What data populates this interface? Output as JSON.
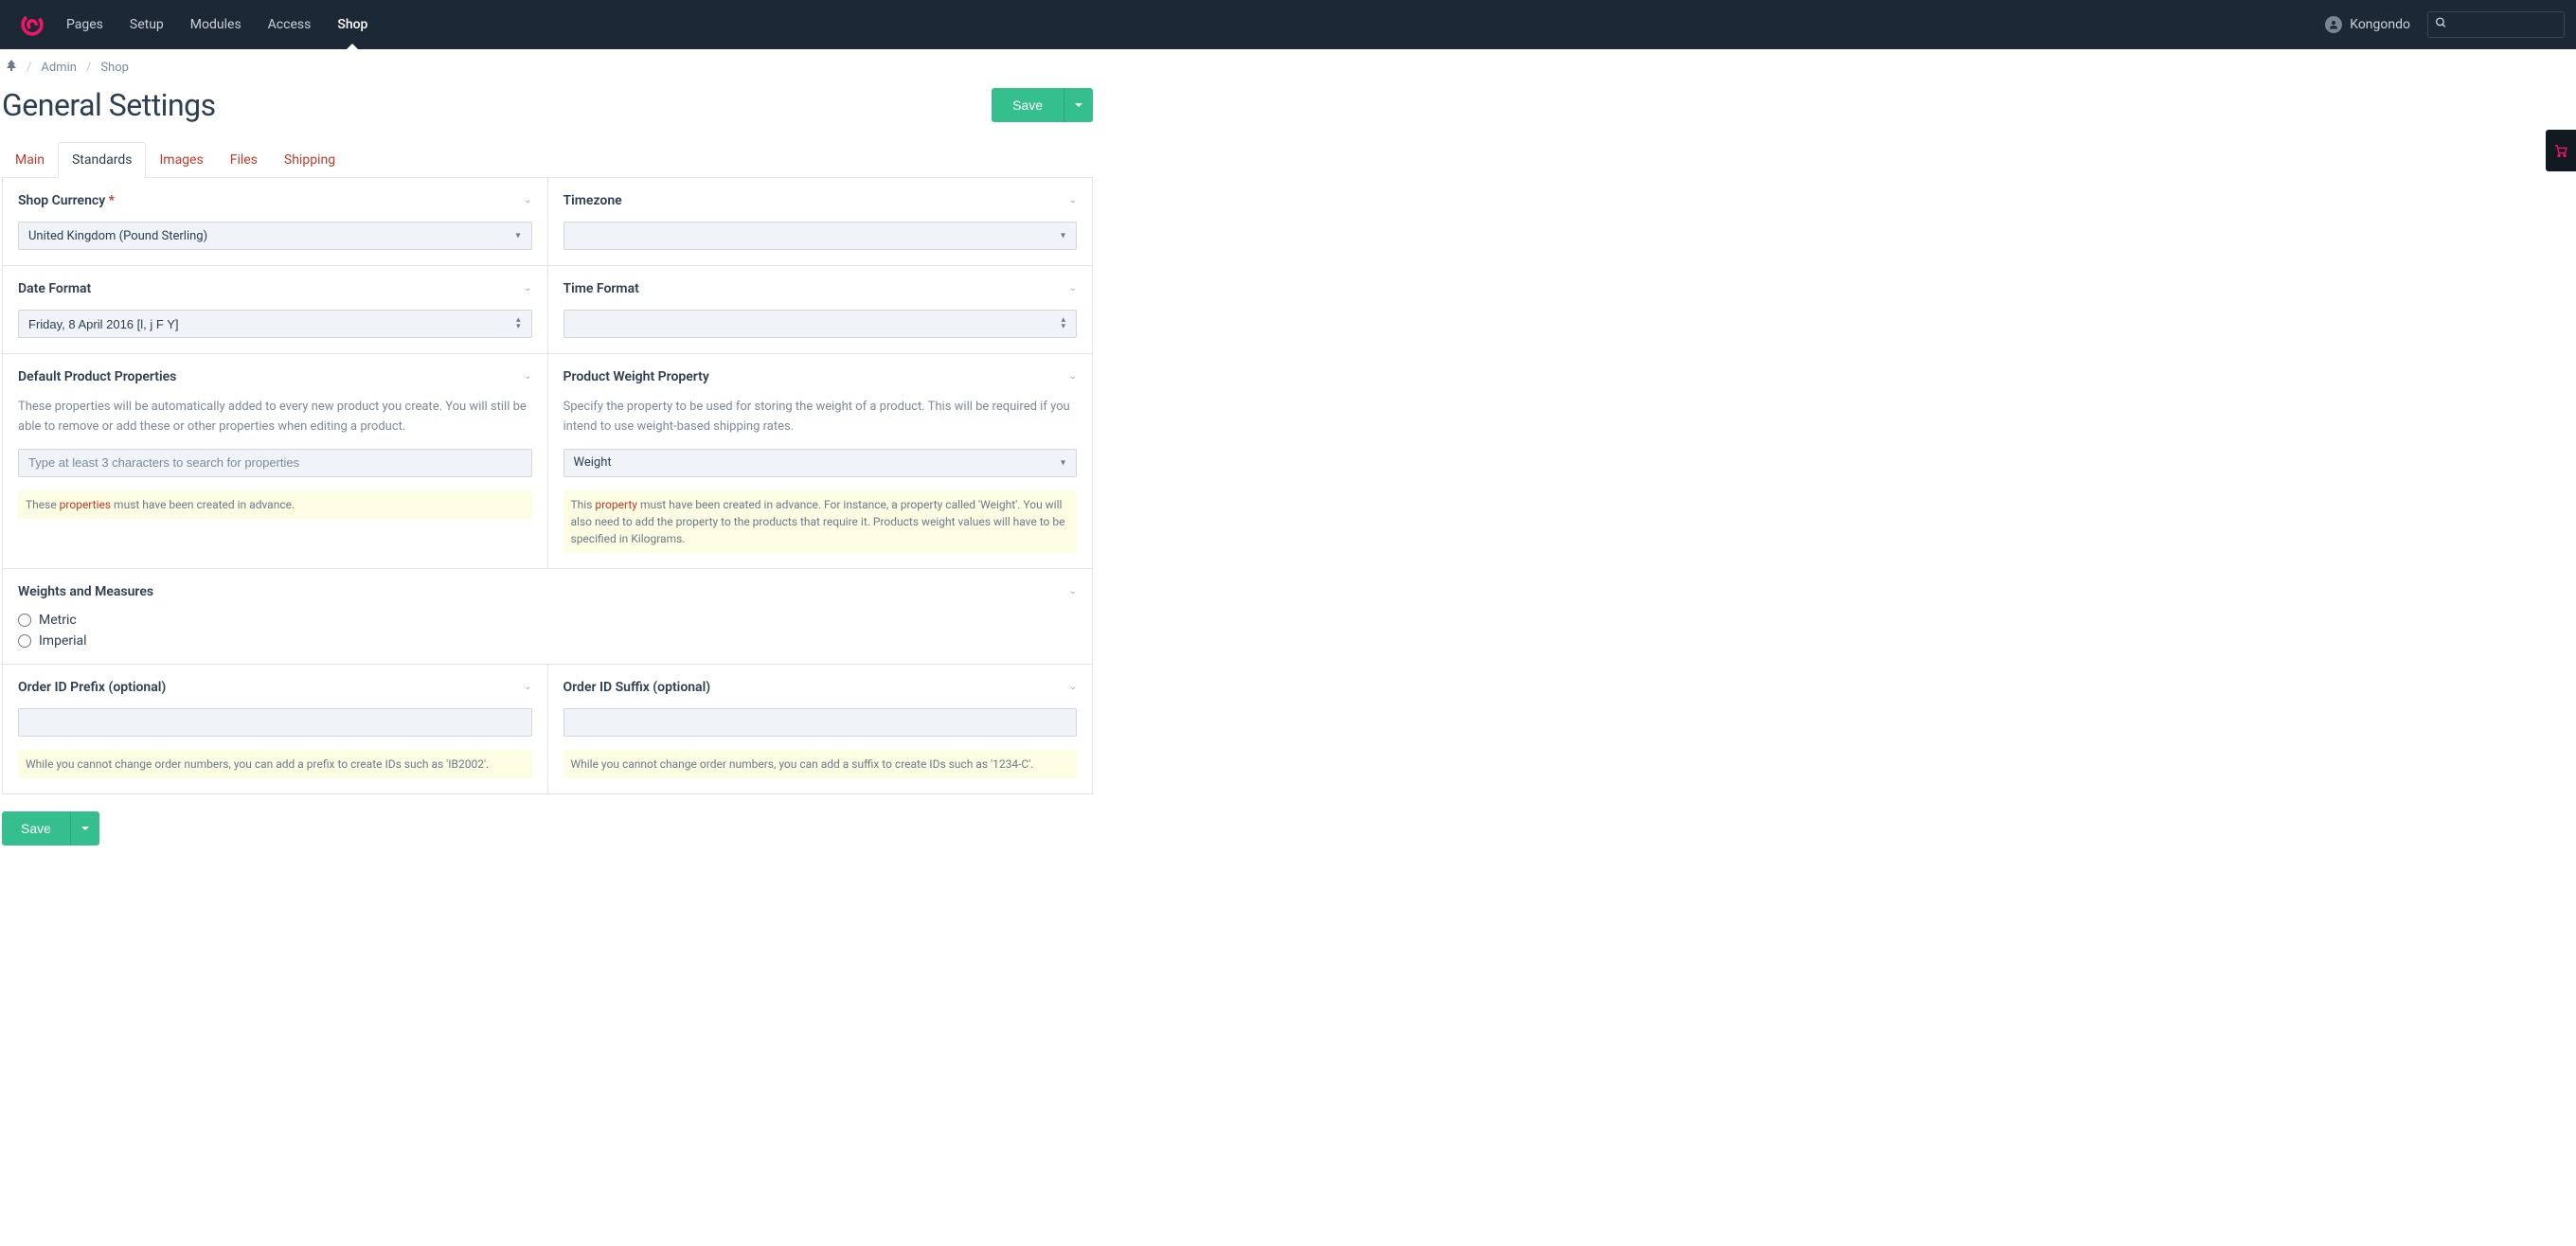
{
  "header": {
    "nav": [
      {
        "label": "Pages",
        "active": false
      },
      {
        "label": "Setup",
        "active": false
      },
      {
        "label": "Modules",
        "active": false
      },
      {
        "label": "Access",
        "active": false
      },
      {
        "label": "Shop",
        "active": true
      }
    ],
    "user": "Kongondo",
    "search_placeholder": ""
  },
  "breadcrumb": {
    "items": [
      "Admin",
      "Shop"
    ]
  },
  "page_title": "General Settings",
  "save_label": "Save",
  "tabs": [
    {
      "label": "Main",
      "active": false
    },
    {
      "label": "Standards",
      "active": true
    },
    {
      "label": "Images",
      "active": false
    },
    {
      "label": "Files",
      "active": false
    },
    {
      "label": "Shipping",
      "active": false
    }
  ],
  "fields": {
    "shop_currency": {
      "label": "Shop Currency",
      "required": true,
      "value": "United Kingdom (Pound Sterling)"
    },
    "timezone": {
      "label": "Timezone",
      "value": ""
    },
    "date_format": {
      "label": "Date Format",
      "value": "Friday, 8 April 2016 [l, j F Y]"
    },
    "time_format": {
      "label": "Time Format",
      "value": ""
    },
    "default_properties": {
      "label": "Default Product Properties",
      "desc": "These properties will be automatically added to every new product you create. You will still be able to remove or add these or other properties when editing a product.",
      "placeholder": "Type at least 3 characters to search for properties",
      "note_pre": "These ",
      "note_link": "properties",
      "note_post": " must have been created in advance."
    },
    "weight_property": {
      "label": "Product Weight Property",
      "desc": "Specify the property to be used for storing the weight of a product. This will be required if you intend to use weight-based shipping rates.",
      "value": "Weight",
      "note_pre": "This ",
      "note_link": "property",
      "note_post": " must have been created in advance. For instance, a property called 'Weight'. You will also need to add the property to the products that require it. Products weight values will have to be specified in Kilograms."
    },
    "weights_measures": {
      "label": "Weights and Measures",
      "options": [
        "Metric",
        "Imperial"
      ]
    },
    "order_prefix": {
      "label": "Order ID Prefix (optional)",
      "value": "",
      "note": "While you cannot change order numbers, you can add a prefix to create IDs such as 'IB2002'."
    },
    "order_suffix": {
      "label": "Order ID Suffix (optional)",
      "value": "",
      "note": "While you cannot change order numbers, you can add a suffix to create IDs such as '1234-C'."
    }
  }
}
